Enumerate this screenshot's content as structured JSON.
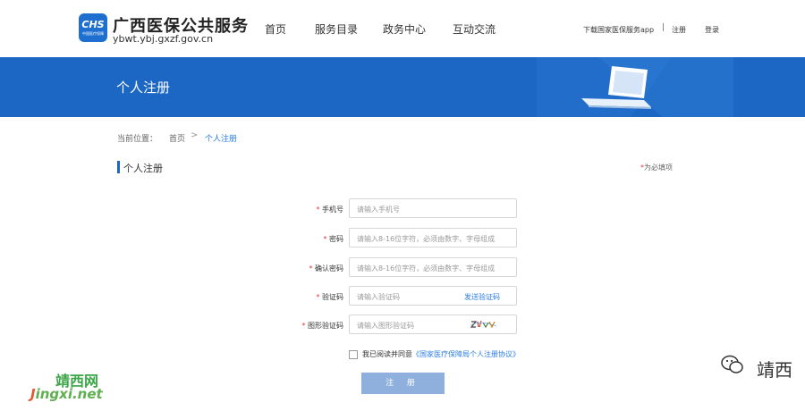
{
  "header": {
    "logo_text": "CHS",
    "logo_sub": "中国医疗保障",
    "brand_title": "广西医保公共服务",
    "brand_url": "ybwt.ybj.gxzf.gov.cn",
    "nav": [
      "首页",
      "服务目录",
      "政务中心",
      "互动交流"
    ],
    "download_app": "下载国家医保服务app",
    "divider": "|",
    "register_link": "注册",
    "login_link": "登录"
  },
  "banner": {
    "title": "个人注册"
  },
  "breadcrumb": {
    "label": "当前位置：",
    "home": "首页",
    "sep": ">",
    "current": "个人注册"
  },
  "section": {
    "title": "个人注册",
    "required_note": "为必填项",
    "required_star": "*"
  },
  "form": {
    "fields": [
      {
        "label": "手机号",
        "placeholder": "请输入手机号"
      },
      {
        "label": "密码",
        "placeholder": "请输入8-16位字符，必须由数字、字母组成"
      },
      {
        "label": "确认密码",
        "placeholder": "请输入8-16位字符，必须由数字、字母组成"
      },
      {
        "label": "验证码",
        "placeholder": "请输入验证码",
        "action": "发送验证码"
      },
      {
        "label": "图形验证码",
        "placeholder": "请输入图形验证码"
      }
    ],
    "star": "*",
    "agree_text": "我已阅读并同意",
    "agree_link": "《国家医疗保障局个人注册协议》",
    "submit": "注 册"
  },
  "watermark": {
    "left_top": "靖西网",
    "left_bottom_j": "J",
    "left_bottom_rest": "ingxi.net",
    "right_text": "靖西"
  },
  "colors": {
    "brand_blue": "#1c67c4",
    "link_blue": "#2a7de1",
    "submit_bg": "#8fb0dc",
    "required_red": "#e03c3c"
  }
}
